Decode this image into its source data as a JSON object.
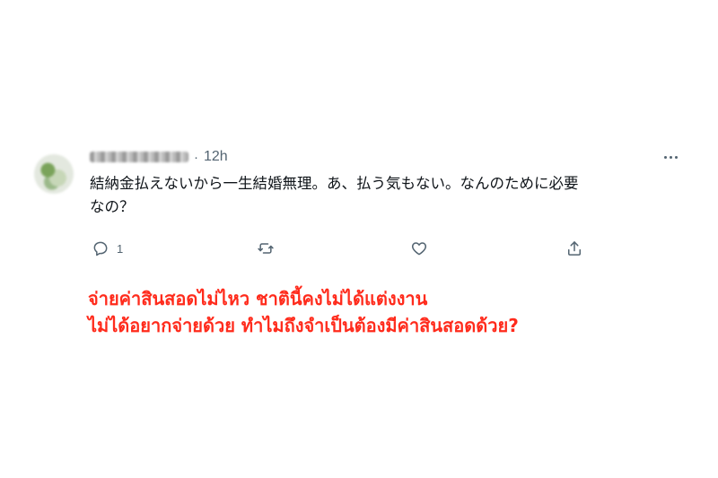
{
  "tweet": {
    "author_name": "",
    "separator": "·",
    "time": "12h",
    "text": "結納金払えないから一生結婚無理。あ、払う気もない。なんのために必要\nなの？",
    "reply_count": "1"
  },
  "icons": {
    "reply": "reply-icon",
    "retweet": "retweet-icon",
    "like": "like-icon",
    "share": "share-icon",
    "more": "more-icon"
  },
  "caption": {
    "line1": "จ่ายค่าสินสอดไม่ไหว ชาตินี้คงไม่ได้แต่งงาน",
    "line2": "ไม่ได้อยากจ่ายด้วย ทำไมถึงจำเป็นต้องมีค่าสินสอดด้วย?"
  },
  "colors": {
    "text": "#0f1419",
    "secondary": "#536471",
    "caption": "#ff2b1c"
  }
}
